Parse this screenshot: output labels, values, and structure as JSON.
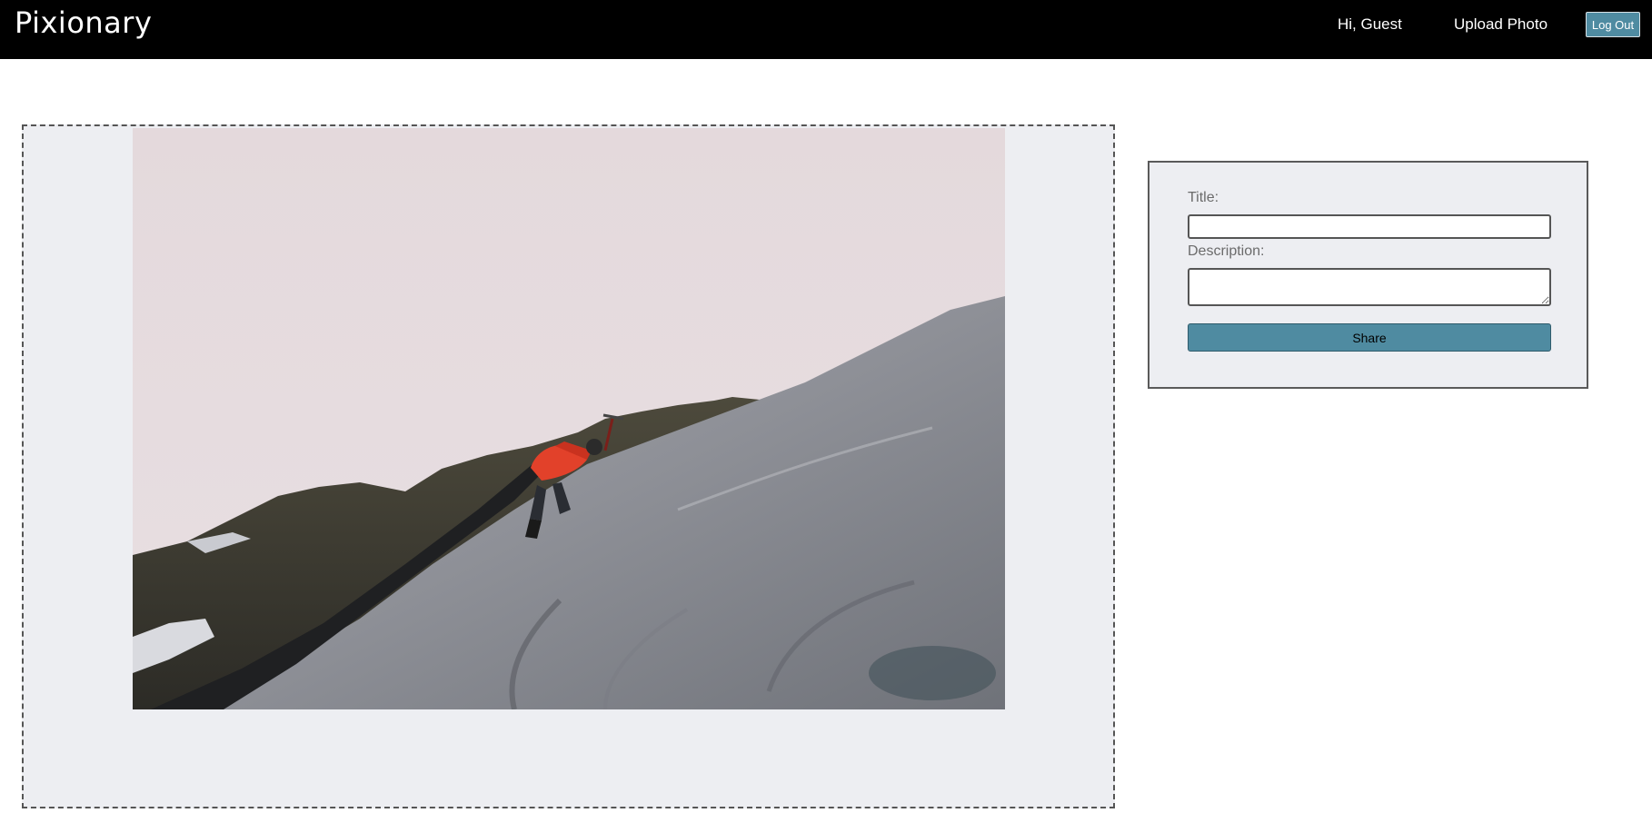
{
  "navbar": {
    "brand": "Pixionary",
    "greeting": "Hi, Guest",
    "upload_link": "Upload Photo",
    "logout_label": "Log Out"
  },
  "photo": {
    "alt": "Climber with red jacket and ice axe ascending a snowy slope"
  },
  "form": {
    "title_label": "Title:",
    "title_value": "",
    "description_label": "Description:",
    "description_value": "",
    "share_label": "Share"
  },
  "colors": {
    "navbar_bg": "#000000",
    "accent": "#4f8ba1",
    "panel_bg": "#edeef2"
  }
}
